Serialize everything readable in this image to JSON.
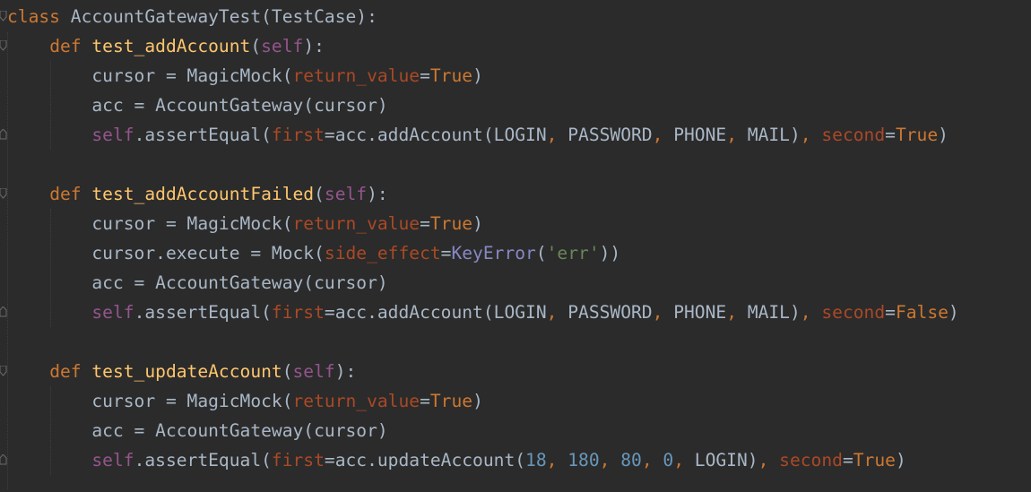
{
  "editor": {
    "lines": [
      {
        "tokens": [
          {
            "t": "class",
            "c": "kw"
          },
          {
            "t": " AccountGatewayTest(TestCase):",
            "c": "plain"
          }
        ]
      },
      {
        "tokens": [
          {
            "t": "    ",
            "c": "plain"
          },
          {
            "t": "def",
            "c": "kw"
          },
          {
            "t": " ",
            "c": "plain"
          },
          {
            "t": "test_addAccount",
            "c": "fn"
          },
          {
            "t": "(",
            "c": "plain"
          },
          {
            "t": "self",
            "c": "self"
          },
          {
            "t": "):",
            "c": "plain"
          }
        ]
      },
      {
        "tokens": [
          {
            "t": "        cursor = MagicMock(",
            "c": "plain"
          },
          {
            "t": "return_value",
            "c": "param"
          },
          {
            "t": "=",
            "c": "plain"
          },
          {
            "t": "True",
            "c": "bool"
          },
          {
            "t": ")",
            "c": "plain"
          }
        ]
      },
      {
        "tokens": [
          {
            "t": "        acc = AccountGateway(cursor)",
            "c": "plain"
          }
        ]
      },
      {
        "tokens": [
          {
            "t": "        ",
            "c": "plain"
          },
          {
            "t": "self",
            "c": "self"
          },
          {
            "t": ".assertEqual(",
            "c": "plain"
          },
          {
            "t": "first",
            "c": "param"
          },
          {
            "t": "=acc.addAccount(LOGIN",
            "c": "plain"
          },
          {
            "t": ",",
            "c": "kw"
          },
          {
            "t": " PASSWORD",
            "c": "plain"
          },
          {
            "t": ",",
            "c": "kw"
          },
          {
            "t": " PHONE",
            "c": "plain"
          },
          {
            "t": ",",
            "c": "kw"
          },
          {
            "t": " MAIL)",
            "c": "plain"
          },
          {
            "t": ",",
            "c": "kw"
          },
          {
            "t": " ",
            "c": "plain"
          },
          {
            "t": "second",
            "c": "param"
          },
          {
            "t": "=",
            "c": "plain"
          },
          {
            "t": "True",
            "c": "bool"
          },
          {
            "t": ")",
            "c": "plain"
          }
        ]
      },
      {
        "tokens": []
      },
      {
        "tokens": [
          {
            "t": "    ",
            "c": "plain"
          },
          {
            "t": "def",
            "c": "kw"
          },
          {
            "t": " ",
            "c": "plain"
          },
          {
            "t": "test_addAccountFailed",
            "c": "fn"
          },
          {
            "t": "(",
            "c": "plain"
          },
          {
            "t": "self",
            "c": "self"
          },
          {
            "t": "):",
            "c": "plain"
          }
        ]
      },
      {
        "tokens": [
          {
            "t": "        cursor = MagicMock(",
            "c": "plain"
          },
          {
            "t": "return_value",
            "c": "param"
          },
          {
            "t": "=",
            "c": "plain"
          },
          {
            "t": "True",
            "c": "bool"
          },
          {
            "t": ")",
            "c": "plain"
          }
        ]
      },
      {
        "tokens": [
          {
            "t": "        cursor.execute = Mock(",
            "c": "plain"
          },
          {
            "t": "side_effect",
            "c": "param"
          },
          {
            "t": "=",
            "c": "plain"
          },
          {
            "t": "KeyError",
            "c": "builtin"
          },
          {
            "t": "(",
            "c": "plain"
          },
          {
            "t": "'err'",
            "c": "str"
          },
          {
            "t": "))",
            "c": "plain"
          }
        ]
      },
      {
        "tokens": [
          {
            "t": "        acc = AccountGateway(cursor)",
            "c": "plain"
          }
        ]
      },
      {
        "tokens": [
          {
            "t": "        ",
            "c": "plain"
          },
          {
            "t": "self",
            "c": "self"
          },
          {
            "t": ".assertEqual(",
            "c": "plain"
          },
          {
            "t": "first",
            "c": "param"
          },
          {
            "t": "=acc.addAccount(LOGIN",
            "c": "plain"
          },
          {
            "t": ",",
            "c": "kw"
          },
          {
            "t": " PASSWORD",
            "c": "plain"
          },
          {
            "t": ",",
            "c": "kw"
          },
          {
            "t": " PHONE",
            "c": "plain"
          },
          {
            "t": ",",
            "c": "kw"
          },
          {
            "t": " MAIL)",
            "c": "plain"
          },
          {
            "t": ",",
            "c": "kw"
          },
          {
            "t": " ",
            "c": "plain"
          },
          {
            "t": "second",
            "c": "param"
          },
          {
            "t": "=",
            "c": "plain"
          },
          {
            "t": "False",
            "c": "bool"
          },
          {
            "t": ")",
            "c": "plain"
          }
        ]
      },
      {
        "tokens": []
      },
      {
        "tokens": [
          {
            "t": "    ",
            "c": "plain"
          },
          {
            "t": "def",
            "c": "kw"
          },
          {
            "t": " ",
            "c": "plain"
          },
          {
            "t": "test_updateAccount",
            "c": "fn"
          },
          {
            "t": "(",
            "c": "plain"
          },
          {
            "t": "self",
            "c": "self"
          },
          {
            "t": "):",
            "c": "plain"
          }
        ]
      },
      {
        "tokens": [
          {
            "t": "        cursor = MagicMock(",
            "c": "plain"
          },
          {
            "t": "return_value",
            "c": "param"
          },
          {
            "t": "=",
            "c": "plain"
          },
          {
            "t": "True",
            "c": "bool"
          },
          {
            "t": ")",
            "c": "plain"
          }
        ]
      },
      {
        "tokens": [
          {
            "t": "        acc = AccountGateway(cursor)",
            "c": "plain"
          }
        ]
      },
      {
        "tokens": [
          {
            "t": "        ",
            "c": "plain"
          },
          {
            "t": "self",
            "c": "self"
          },
          {
            "t": ".assertEqual(",
            "c": "plain"
          },
          {
            "t": "first",
            "c": "param"
          },
          {
            "t": "=acc.updateAccount(",
            "c": "plain"
          },
          {
            "t": "18",
            "c": "num"
          },
          {
            "t": ",",
            "c": "kw"
          },
          {
            "t": " ",
            "c": "plain"
          },
          {
            "t": "180",
            "c": "num"
          },
          {
            "t": ",",
            "c": "kw"
          },
          {
            "t": " ",
            "c": "plain"
          },
          {
            "t": "80",
            "c": "num"
          },
          {
            "t": ",",
            "c": "kw"
          },
          {
            "t": " ",
            "c": "plain"
          },
          {
            "t": "0",
            "c": "num"
          },
          {
            "t": ",",
            "c": "kw"
          },
          {
            "t": " LOGIN)",
            "c": "plain"
          },
          {
            "t": ",",
            "c": "kw"
          },
          {
            "t": " ",
            "c": "plain"
          },
          {
            "t": "second",
            "c": "param"
          },
          {
            "t": "=",
            "c": "plain"
          },
          {
            "t": "True",
            "c": "bool"
          },
          {
            "t": ")",
            "c": "plain"
          }
        ]
      }
    ]
  }
}
